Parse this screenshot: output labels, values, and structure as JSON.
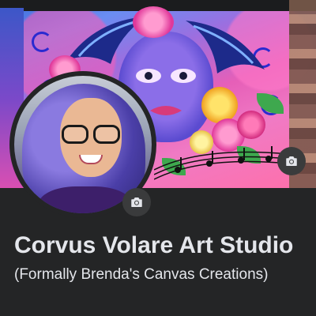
{
  "page": {
    "name": "Corvus Volare Art Studio",
    "former_name": "(Formally Brenda's Canvas Creations)"
  },
  "cover": {
    "camera_icon": "camera-icon"
  },
  "profile": {
    "camera_icon": "camera-icon"
  },
  "colors": {
    "background": "#242526",
    "button": "#3a3b3c",
    "text": "#e4e6eb"
  }
}
